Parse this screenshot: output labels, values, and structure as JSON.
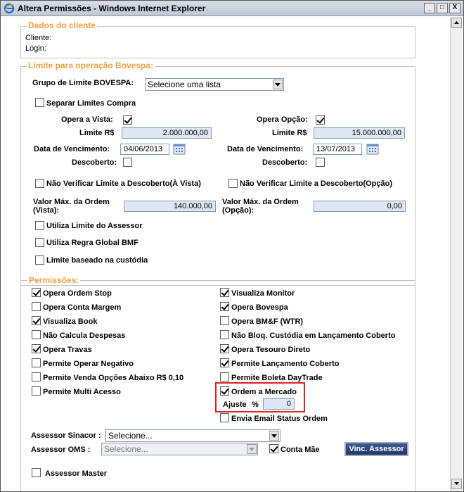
{
  "window": {
    "title": "Altera Permissões - Windows Internet Explorer",
    "minimize": "_",
    "maximize": "□",
    "close": "X"
  },
  "cliente": {
    "legend": "Dados do cliente",
    "cliente_label": "Cliente:",
    "login_label": "Login:"
  },
  "bovespa": {
    "legend": "Limite para operação Bovespa:",
    "grupo_label": "Grupo de Limite BOVESPA:",
    "grupo_value": "Selecione uma lista",
    "separar_label": "Separar Limites Compra",
    "vista": {
      "opera_label": "Opera a Vista:",
      "limite_label": "Limite R$",
      "limite_value": "2.000.000,00",
      "vencimento_label": "Data de Vencimento:",
      "vencimento_value": "04/06/2013",
      "descoberto_label": "Descoberto:"
    },
    "opcao": {
      "opera_label": "Opera Opção:",
      "limite_label": "Limite R$",
      "limite_value": "15.000.000,00",
      "vencimento_label": "Data de Vencimento:",
      "vencimento_value": "13/07/2013",
      "descoberto_label": "Descoberto:"
    },
    "nao_verificar_vista": "Não Verificar Limite a Descoberto(À Vista)",
    "nao_verificar_opcao": "Não Verificar Limite a Descoberto(Opção)",
    "valor_max_vista_label_1": "Valor Máx. da Ordem",
    "valor_max_vista_label_2": "(Vista):",
    "valor_max_vista_value": "140.000,00",
    "valor_max_opcao_label_1": "Valor Máx. da Ordem",
    "valor_max_opcao_label_2": "(Opção):",
    "valor_max_opcao_value": "0,00",
    "utiliza_assessor": "Utiliza Limite do Assessor",
    "utiliza_bmf": "Utiliza Regra Global BMF",
    "limite_custodia": "Limite baseado na custódia"
  },
  "permissoes": {
    "legend": "Permissões:",
    "left": [
      {
        "label": "Opera Ordem Stop",
        "checked": true
      },
      {
        "label": "Opera Conta Margem",
        "checked": false
      },
      {
        "label": "Visualiza Book",
        "checked": true
      },
      {
        "label": "Não Calcula Despesas",
        "checked": false
      },
      {
        "label": "Opera Travas",
        "checked": true
      },
      {
        "label": "Permite Operar Negativo",
        "checked": false
      },
      {
        "label": "Permite Venda Opções Abaixo R$ 0,10",
        "checked": false
      },
      {
        "label": "Permite Multi Acesso",
        "checked": false
      }
    ],
    "right": [
      {
        "label": "Visualiza Monitor",
        "checked": true
      },
      {
        "label": "Opera Bovespa",
        "checked": true
      },
      {
        "label": "Opera BM&F (WTR)",
        "checked": false
      },
      {
        "label": "Não Bloq. Custódia em Lançamento Coberto",
        "checked": false
      },
      {
        "label": "Opera Tesouro Direto",
        "checked": true
      },
      {
        "label": "Permite Lançamento Coberto",
        "checked": true
      },
      {
        "label": "Permite Boleta DayTrade",
        "checked": false
      },
      {
        "label": "Ordem a Mercado",
        "checked": true
      }
    ],
    "ajuste_label": "Ajuste",
    "ajuste_pct": "%",
    "ajuste_value": "0",
    "envia_email": "Envia Email Status Ordem",
    "sinacor_label": "Assessor Sinacor :",
    "sinacor_value": "Selecione...",
    "oms_label": "Assessor OMS :",
    "oms_value": "Selecione...",
    "conta_mae": "Conta Mãe",
    "vinc_button": "Vinc. Assessor",
    "assessor_master": "Assessor Master"
  }
}
